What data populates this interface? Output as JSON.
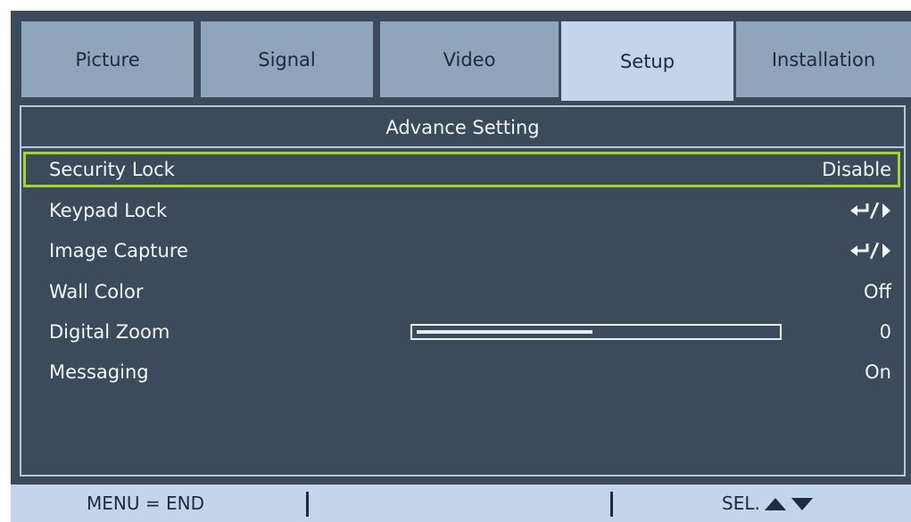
{
  "tabs": [
    {
      "label": "Picture",
      "active": false
    },
    {
      "label": "Signal",
      "active": false
    },
    {
      "label": "Video",
      "active": false
    },
    {
      "label": "Setup",
      "active": true
    },
    {
      "label": "Installation",
      "active": false
    }
  ],
  "panel": {
    "title": "Advance Setting",
    "rows": [
      {
        "label": "Security Lock",
        "value": "Disable"
      },
      {
        "label": "Keypad Lock",
        "icon": "enter-right-icon"
      },
      {
        "label": "Image Capture",
        "icon": "enter-right-icon"
      },
      {
        "label": "Wall Color",
        "value": "Off"
      },
      {
        "label": "Digital Zoom",
        "value": "0",
        "slider_fill_fraction": 0.49
      },
      {
        "label": "Messaging",
        "value": "On"
      }
    ]
  },
  "footer": {
    "menu_label": "MENU = END",
    "select_label": "SEL.",
    "select_icons": [
      "up-arrow-icon",
      "down-arrow-icon"
    ]
  },
  "colors": {
    "background": "#3d4a5b",
    "tab_inactive": "#8ea5bc",
    "tab_active": "#c3d5ea",
    "selection_border": "#a3d52b",
    "text": "#f2f6fa"
  }
}
